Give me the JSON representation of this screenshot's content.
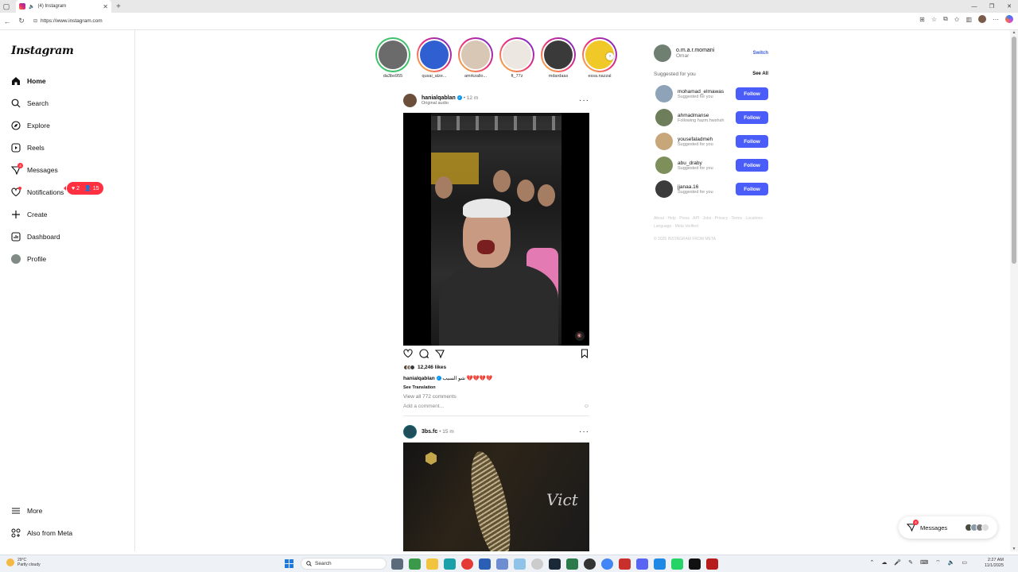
{
  "browser": {
    "tab_title": "(4) Instagram",
    "url": "https://www.instagram.com"
  },
  "sidebar": {
    "logo": "Instagram",
    "items": [
      {
        "label": "Home",
        "icon": "home-icon"
      },
      {
        "label": "Search",
        "icon": "search-icon"
      },
      {
        "label": "Explore",
        "icon": "compass-icon"
      },
      {
        "label": "Reels",
        "icon": "reels-icon"
      },
      {
        "label": "Messages",
        "icon": "messenger-icon",
        "badge": "4"
      },
      {
        "label": "Notifications",
        "icon": "heart-icon"
      },
      {
        "label": "Create",
        "icon": "plus-icon"
      },
      {
        "label": "Dashboard",
        "icon": "dashboard-icon"
      },
      {
        "label": "Profile",
        "icon": "avatar"
      }
    ],
    "notifications_pill": {
      "likes": "2",
      "follows": "15"
    },
    "more": "More",
    "also_from_meta": "Also from Meta"
  },
  "stories": [
    {
      "name": "da3bo955",
      "seen": true,
      "color": "#6b6b6b"
    },
    {
      "name": "qusai_alze...",
      "seen": false,
      "color": "#2f5fd0"
    },
    {
      "name": "amrkzallo...",
      "seen": false,
      "color": "#d9c7b5"
    },
    {
      "name": "ft_77z",
      "seen": false,
      "color": "#ece7e0"
    },
    {
      "name": "mdardaas",
      "seen": false,
      "color": "#3a3a3a"
    },
    {
      "name": "essa.nazzal",
      "seen": false,
      "color": "#f0c929"
    }
  ],
  "post1": {
    "user": "hanialqablan",
    "time": "12 m",
    "audio": "Original audio",
    "likes": "12,246 likes",
    "caption": "شو السبب 💔💔💔💔",
    "see_translation": "See Translation",
    "view_comments": "View all 772 comments",
    "add_comment": "Add a comment..."
  },
  "post2": {
    "user": "3bs.fc",
    "time": "15 m",
    "media_text": "Vict"
  },
  "profile": {
    "username": "o.m.a.r.momani",
    "name": "Omar",
    "switch": "Switch"
  },
  "suggestions": {
    "title": "Suggested for you",
    "see_all": "See All",
    "follow_label": "Follow",
    "items": [
      {
        "user": "mohamad_elmawas",
        "sub": "Suggested for you",
        "color": "#8fa3b8"
      },
      {
        "user": "ahmadmanse",
        "sub": "Following hazm.hwshsh",
        "color": "#6e7d5a"
      },
      {
        "user": "yousefaladmeh",
        "sub": "Suggested for you",
        "color": "#c7a67a"
      },
      {
        "user": "abu_draby",
        "sub": "Suggested for you",
        "color": "#7d8f5b"
      },
      {
        "user": "jjanaa.16",
        "sub": "Suggested for you",
        "color": "#3b3b3b"
      }
    ]
  },
  "footer": {
    "links": "About · Help · Press · API · Jobs · Privacy · Terms · Locations · Language · Meta Verified",
    "copyright": "© 2025 INSTAGRAM FROM META"
  },
  "messages_float": {
    "label": "Messages",
    "badge": "4"
  },
  "taskbar": {
    "temp": "29°C",
    "weather": "Partly cloudy",
    "search": "Search",
    "time": "2:27 AM",
    "date": "11/1/2025"
  },
  "colors": {
    "accent": "#4a5df9",
    "badge": "#ff3040",
    "link": "#3b5bdb"
  }
}
